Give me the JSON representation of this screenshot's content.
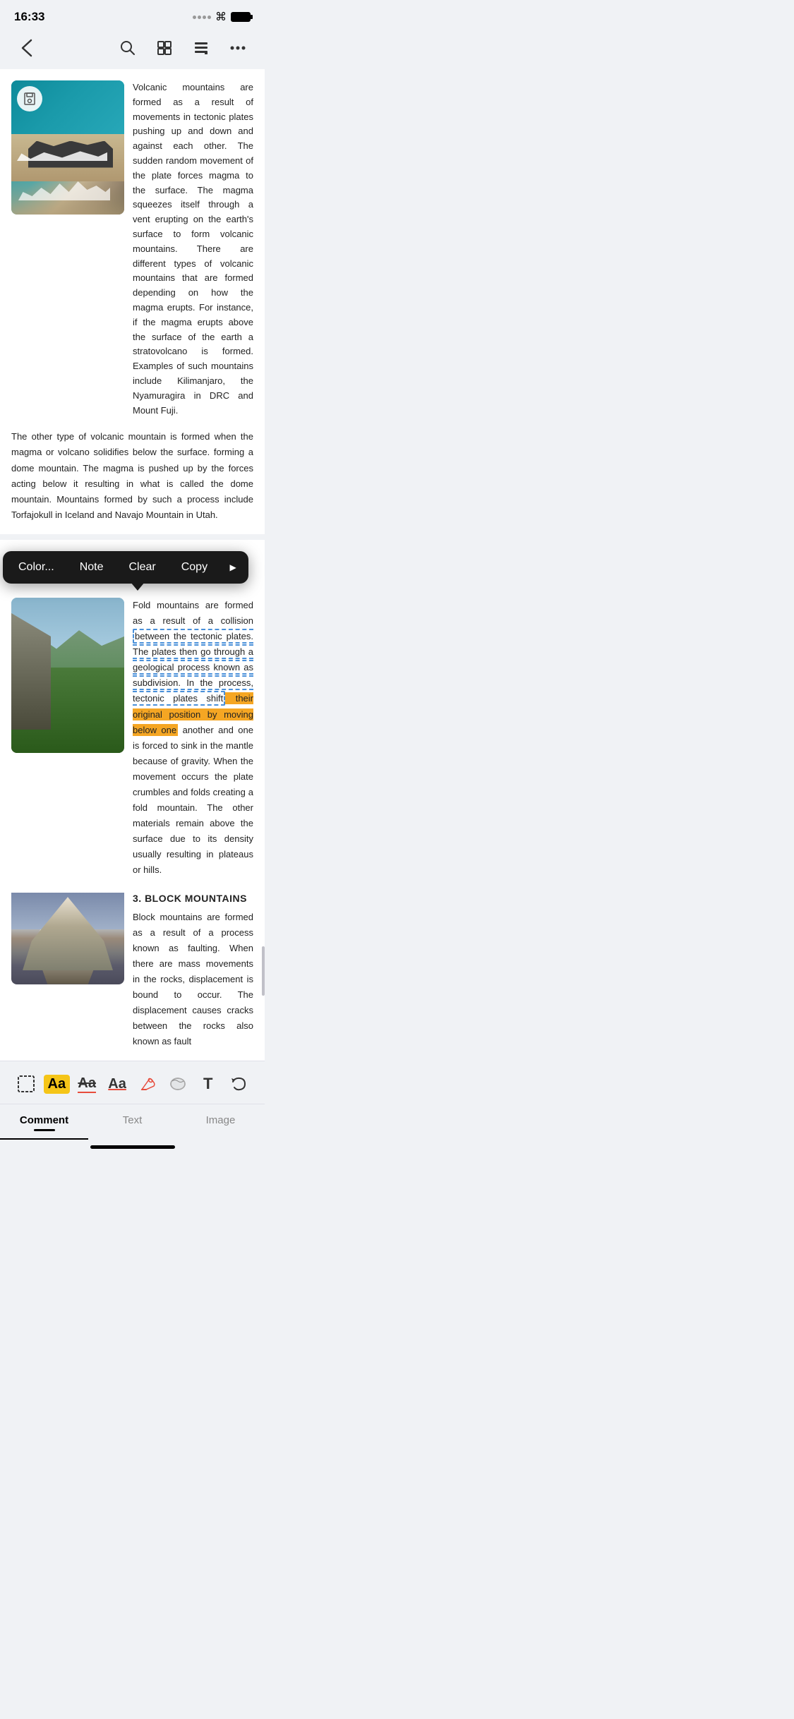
{
  "statusBar": {
    "time": "16:33"
  },
  "toolbar": {
    "back": "‹",
    "search": "search",
    "grid": "grid",
    "list": "list",
    "more": "more"
  },
  "article1": {
    "text": "Volcanic mountains are formed as a result of movements in tectonic plates pushing up and down and against each other. The sudden random movement of the plate forces magma to the surface. The magma squeezes itself through a vent erupting on the earth's surface to form volcanic mountains. There are different types of volcanic mountains that are formed depending on how the magma erupts. For instance, if the magma erupts above the surface of the earth a stratovolcano is formed. Examples of such mountains include Kilimanjaro, the Nyamuragira in DRC and Mount Fuji.",
    "continuation": "The other type of volcanic mountain is formed when the magma or volcano solidifies below the surface. forming a dome mountain. The magma is pushed up by the forces acting below it resulting in what is called the dome mountain. Mountains formed by such a process include Torfajokull in Iceland and Navajo Mountain in Utah."
  },
  "contextMenu": {
    "color": "Color...",
    "note": "Note",
    "clear": "Clear",
    "copy": "Copy",
    "arrow": "▶"
  },
  "article2": {
    "textBefore": "Fold mountains are formed as a result of a collision ",
    "textHighlightDashed": "between the tectonic plates. The plates then go through a geological process known as subdivision. In the process, tectonic plates shift",
    "textHighlightOrange": " their original position by moving below one",
    "textAfter": " another and one is forced to sink in the mantle because of gravity. When the movement occurs the plate crumbles and folds creating a fold mountain. The other materials remain above the surface due to its density usually resulting in plateaus or hills."
  },
  "article3": {
    "sectionTitle": "3. BLOCK MOUNTAINS",
    "text": "Block mountains are formed as a result of a process known as faulting. When there are mass movements in the rocks, displacement is bound to occur. The displacement causes cracks between the rocks also known as fault"
  },
  "bottomToolbar": {
    "select": "select",
    "textHighlight": "Aa",
    "textStrike": "Aa",
    "textUnderline": "Aa",
    "eraser": "eraser",
    "rubber": "rubber",
    "textInsert": "T",
    "undo": "undo"
  },
  "bottomTabs": {
    "comment": "Comment",
    "text": "Text",
    "image": "Image"
  }
}
